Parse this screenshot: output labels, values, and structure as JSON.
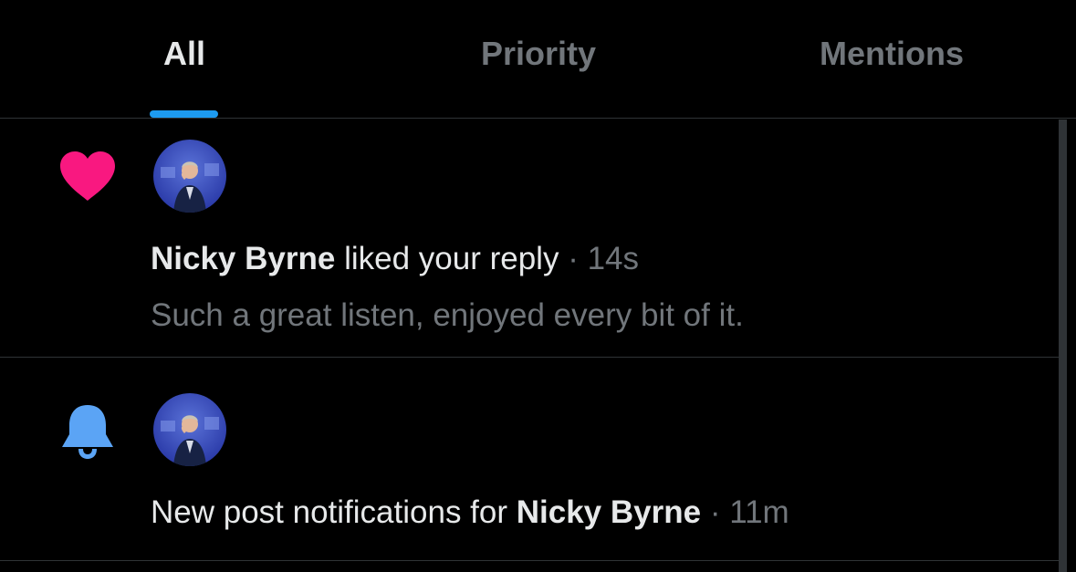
{
  "tabs": {
    "all": "All",
    "priority": "Priority",
    "mentions": "Mentions"
  },
  "notifications": [
    {
      "type_icon": "heart-icon",
      "user": "Nicky Byrne",
      "action": "liked your reply",
      "separator": "·",
      "time": "14s",
      "snippet": "Such a great listen, enjoyed every bit of it."
    },
    {
      "type_icon": "bell-icon",
      "prefix": "New post notifications for",
      "user": "Nicky Byrne",
      "separator": "·",
      "time": "11m"
    }
  ],
  "colors": {
    "accent": "#1d9bf0",
    "like": "#f91880",
    "muted": "#71767b",
    "divider": "#2f3336"
  }
}
